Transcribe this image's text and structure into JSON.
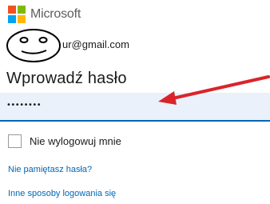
{
  "brand": {
    "name": "Microsoft",
    "logo_colors": [
      "#f25022",
      "#7fba00",
      "#00a4ef",
      "#ffb900"
    ]
  },
  "account": {
    "email_visible": "ur@gmail.com",
    "overlay_icon": "smiley-face-doodle-icon"
  },
  "form": {
    "title": "Wprowadź hasło",
    "password_masked": "••••••••",
    "annotation_icon": "red-arrow-icon",
    "annotation_color": "#d9252a",
    "keep_signed_in_label": "Nie wylogowuj mnie",
    "keep_signed_in_checked": false
  },
  "links": {
    "forgot_password": "Nie pamiętasz hasła?",
    "other_ways": "Inne sposoby logowania się"
  },
  "colors": {
    "accent": "#0067b8",
    "field_background": "#eaf1fb"
  }
}
